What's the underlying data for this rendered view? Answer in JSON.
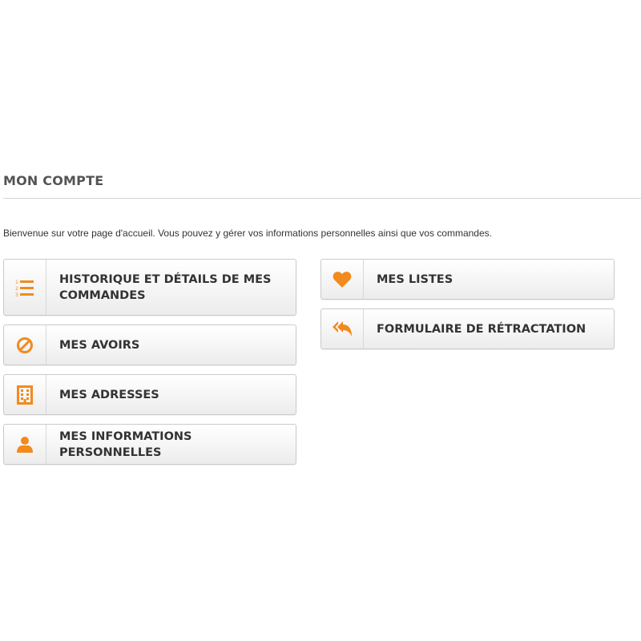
{
  "page": {
    "title": "MON COMPTE",
    "intro": "Bienvenue sur votre page d'accueil. Vous pouvez y gérer vos informations personnelles ainsi que vos commandes."
  },
  "colors": {
    "accent": "#f28a1e",
    "heading": "#555454",
    "text": "#333333",
    "border": "#cacaca"
  },
  "left_column": [
    {
      "label": "HISTORIQUE ET DÉTAILS DE MES COMMANDES",
      "icon": "numbered-list-icon"
    },
    {
      "label": "MES AVOIRS",
      "icon": "ban-icon"
    },
    {
      "label": "MES ADRESSES",
      "icon": "building-icon"
    },
    {
      "label": "MES INFORMATIONS PERSONNELLES",
      "icon": "user-icon"
    }
  ],
  "right_column": [
    {
      "label": "MES LISTES",
      "icon": "heart-icon"
    },
    {
      "label": "FORMULAIRE DE RÉTRACTATION",
      "icon": "reply-all-icon"
    }
  ]
}
